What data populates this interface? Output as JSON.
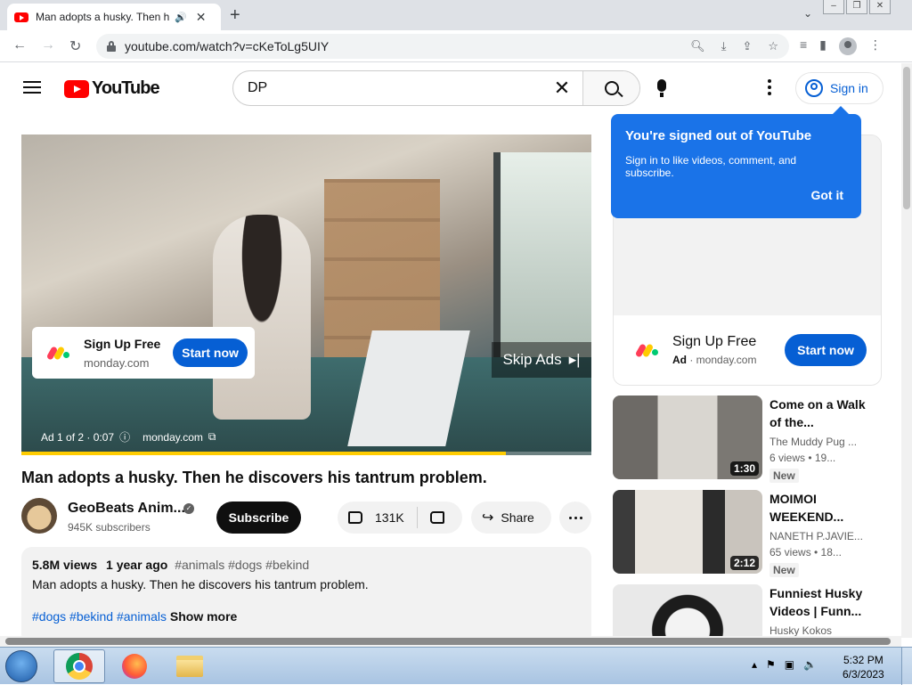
{
  "browser": {
    "tab_title": "Man adopts a husky. Then h",
    "new_tab": "+",
    "url": "youtube.com/watch?v=cKeToLg5UIY",
    "window_controls": [
      "–",
      "❐",
      "✕"
    ]
  },
  "header": {
    "logo_text": "YouTube",
    "search_query": "DP",
    "signin_label": "Sign in"
  },
  "player": {
    "ad_card": {
      "title": "Sign Up Free",
      "domain": "monday.com",
      "cta": "Start now"
    },
    "skip_label": "Skip Ads",
    "ad_counter": "Ad 1 of 2 · 0:07",
    "ad_domain": "monday.com",
    "progress": 0.85,
    "progress_color": "#ffcc00"
  },
  "video": {
    "title": "Man adopts a husky. Then he discovers his tantrum problem.",
    "channel": {
      "name": "GeoBeats Anim...",
      "subscribers": "945K subscribers",
      "subscribe_label": "Subscribe"
    },
    "likes": "131K",
    "share_label": "Share",
    "description": {
      "views": "5.8M views",
      "age": "1 year ago",
      "hashtags": "#animals #dogs #bekind",
      "text": "Man adopts a husky. Then he discovers his tantrum problem.",
      "tags_bottom": "#dogs #bekind #animals",
      "show_more": "Show more"
    }
  },
  "tooltip": {
    "heading": "You're signed out of YouTube",
    "body": "Sign in to like videos, comment, and subscribe.",
    "button": "Got it"
  },
  "sidebar_ad": {
    "title": "Sign Up Free",
    "ad_label": "Ad",
    "domain": "· monday.com",
    "cta": "Start now"
  },
  "recommendations": [
    {
      "title": "Come on a Walk of the...",
      "channel": "The Muddy Pug ...",
      "views": "6 views  • 19...",
      "badge": "New",
      "duration": "1:30"
    },
    {
      "title": "MOIMOI WEEKEND...",
      "channel": "NANETH P.JAVIE...",
      "views": "65 views  • 18...",
      "badge": "New",
      "duration": "2:12"
    },
    {
      "title": "Funniest Husky Videos | Funn...",
      "channel": "Husky Kokos",
      "views": "",
      "badge": "",
      "duration": ""
    }
  ],
  "taskbar": {
    "time": "5:32 PM",
    "date": "6/3/2023"
  },
  "colors": {
    "youtube_red": "#ff0000",
    "link_blue": "#065fd4",
    "tooltip_blue": "#1a73e8"
  }
}
